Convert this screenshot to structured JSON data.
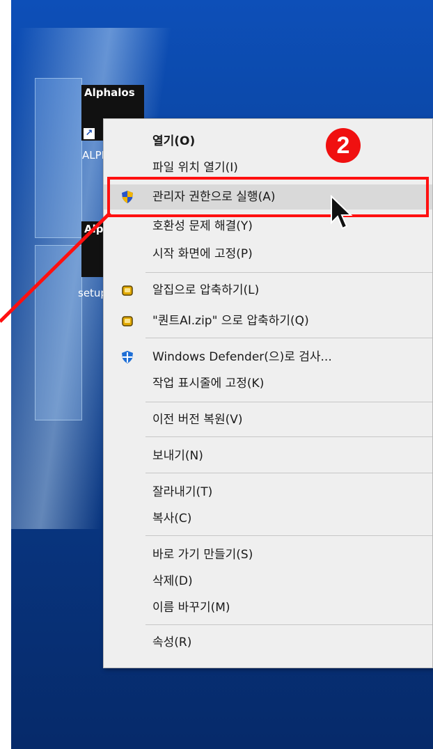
{
  "desktop": {
    "icons": [
      {
        "thumb_title": "Alphalos",
        "label": "ALPH"
      },
      {
        "thumb_title": "Alp",
        "label": "setup"
      }
    ]
  },
  "context_menu": {
    "items": [
      {
        "label": "열기(O)",
        "icon": null,
        "bold": true
      },
      {
        "label": "파일 위치 열기(I)",
        "icon": null
      },
      {
        "label": "관리자 권한으로 실행(A)",
        "icon": "uac-shield-icon",
        "highlighted": true
      },
      {
        "label": "호환성 문제 해결(Y)",
        "icon": null
      },
      {
        "label": "시작 화면에 고정(P)",
        "icon": null
      },
      {
        "label": "알집으로 압축하기(L)",
        "icon": "alzip-icon"
      },
      {
        "label": "\"퀀트AI.zip\" 으로 압축하기(Q)",
        "icon": "alzip-icon"
      },
      {
        "label": "Windows Defender(으)로 검사...",
        "icon": "windows-defender-icon"
      },
      {
        "label": "작업 표시줄에 고정(K)",
        "icon": null
      },
      {
        "label": "이전 버전 복원(V)",
        "icon": null
      },
      {
        "label": "보내기(N)",
        "icon": null
      },
      {
        "label": "잘라내기(T)",
        "icon": null
      },
      {
        "label": "복사(C)",
        "icon": null
      },
      {
        "label": "바로 가기 만들기(S)",
        "icon": null
      },
      {
        "label": "삭제(D)",
        "icon": null
      },
      {
        "label": "이름 바꾸기(M)",
        "icon": null
      },
      {
        "label": "속성(R)",
        "icon": null
      }
    ]
  },
  "annotation": {
    "step_number": "2",
    "color": "#ff1010"
  },
  "colors": {
    "desktop_blue": "#0d4fb8",
    "menu_bg": "#efefef",
    "highlight_bg": "#d9d9d9"
  }
}
